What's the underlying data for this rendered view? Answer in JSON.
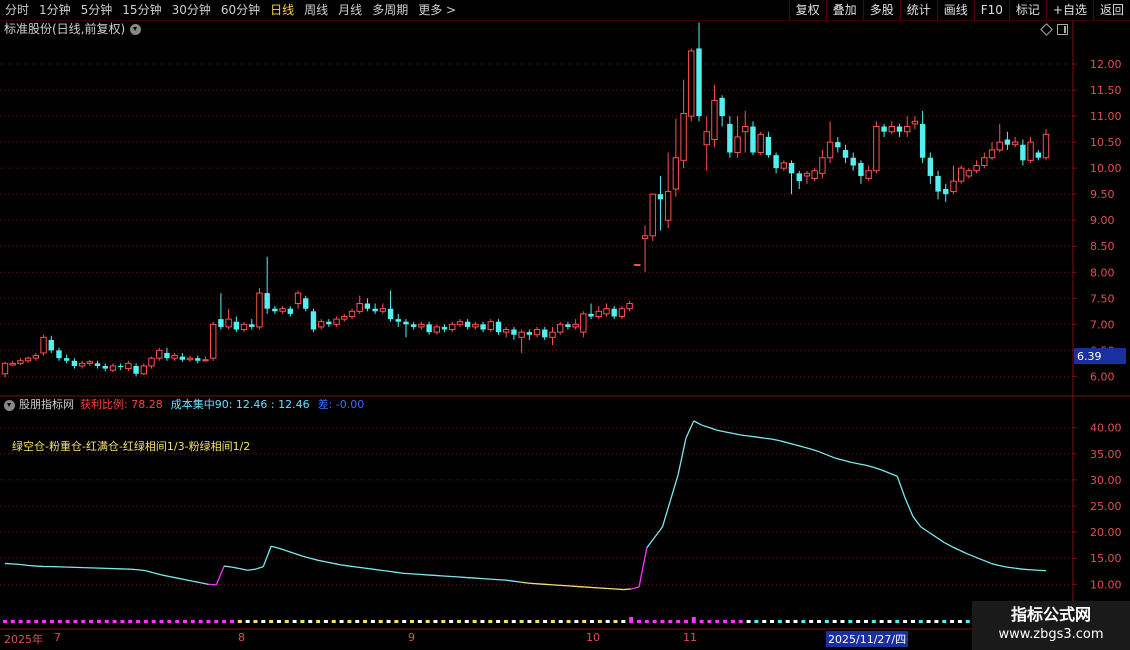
{
  "toolbar": {
    "periods": [
      "分时",
      "1分钟",
      "5分钟",
      "15分钟",
      "30分钟",
      "60分钟",
      "日线",
      "周线",
      "月线",
      "多周期",
      "更多 >"
    ],
    "active_period": "日线",
    "buttons": [
      "复权",
      "叠加",
      "多股",
      "统计",
      "画线",
      "F10",
      "标记",
      "+自选",
      "返回"
    ]
  },
  "chart": {
    "title": "标准股份(日线,前复权)",
    "y_ticks": [
      "12.00",
      "11.50",
      "11.00",
      "10.50",
      "10.00",
      "9.50",
      "9.00",
      "8.50",
      "8.00",
      "7.50",
      "7.00",
      "6.50",
      "6.00"
    ],
    "price_marker": "6.39"
  },
  "indicator": {
    "name": "股朋指标网",
    "profit_label": "获利比例: 78.28",
    "cost_label": "成本集中90: 12.46 : 12.46",
    "diff_label": "差: -0.00",
    "signal_text": "绿空仓-粉重仓-红满仓-红绿相间1/3-粉绿相间1/2",
    "y_ticks": [
      "40.00",
      "35.00",
      "30.00",
      "25.00",
      "20.00",
      "15.00",
      "10.00"
    ]
  },
  "timeline": {
    "year_label": "2025年",
    "months": [
      "7",
      "8",
      "9",
      "10",
      "11"
    ],
    "selected_date": "2025/11/27/四"
  },
  "watermark": {
    "line1": "指标公式网",
    "line2": "www.zbgs3.com"
  },
  "colors": {
    "up": "#ff5050",
    "down": "#54f0f0",
    "grid": "#7a1010",
    "axis_text": "#e05050",
    "accent": "#ffd34a",
    "magenta": "#ff33ff"
  },
  "chart_data": {
    "type": "candlestick",
    "x": "trading days from 2025-06 to 2025-12",
    "ylim": [
      5.7,
      12.5
    ],
    "candles": [
      [
        6.05,
        6.25,
        5.98,
        6.28
      ],
      [
        6.22,
        6.25,
        6.2,
        6.3
      ],
      [
        6.25,
        6.3,
        6.22,
        6.35
      ],
      [
        6.3,
        6.35,
        6.26,
        6.38
      ],
      [
        6.35,
        6.4,
        6.3,
        6.45
      ],
      [
        6.45,
        6.75,
        6.4,
        6.8
      ],
      [
        6.7,
        6.5,
        6.45,
        6.78
      ],
      [
        6.5,
        6.35,
        6.3,
        6.55
      ],
      [
        6.35,
        6.3,
        6.25,
        6.42
      ],
      [
        6.3,
        6.2,
        6.15,
        6.35
      ],
      [
        6.2,
        6.25,
        6.15,
        6.3
      ],
      [
        6.25,
        6.28,
        6.2,
        6.32
      ],
      [
        6.25,
        6.2,
        6.15,
        6.3
      ],
      [
        6.2,
        6.15,
        6.1,
        6.25
      ],
      [
        6.12,
        6.2,
        6.08,
        6.25
      ],
      [
        6.2,
        6.18,
        6.12,
        6.25
      ],
      [
        6.15,
        6.25,
        6.1,
        6.3
      ],
      [
        6.2,
        6.05,
        6.0,
        6.25
      ],
      [
        6.05,
        6.2,
        6.02,
        6.25
      ],
      [
        6.2,
        6.35,
        6.15,
        6.38
      ],
      [
        6.35,
        6.5,
        6.3,
        6.55
      ],
      [
        6.45,
        6.35,
        6.3,
        6.55
      ],
      [
        6.35,
        6.4,
        6.3,
        6.45
      ],
      [
        6.38,
        6.32,
        6.28,
        6.45
      ],
      [
        6.32,
        6.35,
        6.28,
        6.4
      ],
      [
        6.35,
        6.3,
        6.25,
        6.4
      ],
      [
        6.3,
        6.32,
        6.28,
        6.38
      ],
      [
        6.35,
        7.0,
        6.3,
        7.05
      ],
      [
        7.1,
        6.95,
        6.9,
        7.6
      ],
      [
        6.95,
        7.1,
        6.9,
        7.3
      ],
      [
        7.05,
        6.9,
        6.85,
        7.15
      ],
      [
        6.9,
        7.0,
        6.85,
        7.05
      ],
      [
        7.0,
        6.95,
        6.9,
        7.1
      ],
      [
        6.95,
        7.6,
        6.9,
        7.7
      ],
      [
        7.6,
        7.3,
        7.2,
        8.3
      ],
      [
        7.3,
        7.25,
        7.2,
        7.35
      ],
      [
        7.25,
        7.3,
        7.2,
        7.35
      ],
      [
        7.3,
        7.2,
        7.15,
        7.35
      ],
      [
        7.4,
        7.6,
        7.3,
        7.65
      ],
      [
        7.5,
        7.3,
        7.25,
        7.55
      ],
      [
        7.25,
        6.9,
        6.85,
        7.3
      ],
      [
        6.95,
        7.05,
        6.9,
        7.1
      ],
      [
        7.05,
        7.0,
        6.95,
        7.1
      ],
      [
        7.0,
        7.1,
        6.95,
        7.15
      ],
      [
        7.1,
        7.15,
        7.05,
        7.2
      ],
      [
        7.15,
        7.25,
        7.1,
        7.3
      ],
      [
        7.25,
        7.4,
        7.2,
        7.55
      ],
      [
        7.4,
        7.3,
        7.25,
        7.5
      ],
      [
        7.3,
        7.25,
        7.2,
        7.4
      ],
      [
        7.25,
        7.3,
        7.2,
        7.4
      ],
      [
        7.3,
        7.1,
        7.05,
        7.65
      ],
      [
        7.1,
        7.05,
        6.95,
        7.2
      ],
      [
        7.05,
        7.0,
        6.75,
        7.1
      ],
      [
        7.0,
        6.95,
        6.9,
        7.05
      ],
      [
        6.95,
        7.0,
        6.9,
        7.05
      ],
      [
        7.0,
        6.85,
        6.8,
        7.05
      ],
      [
        6.85,
        6.95,
        6.8,
        7.0
      ],
      [
        6.95,
        6.9,
        6.85,
        7.0
      ],
      [
        6.9,
        7.0,
        6.85,
        7.05
      ],
      [
        7.0,
        7.05,
        6.95,
        7.1
      ],
      [
        7.05,
        6.95,
        6.9,
        7.1
      ],
      [
        6.95,
        7.0,
        6.9,
        7.05
      ],
      [
        7.0,
        6.9,
        6.85,
        7.05
      ],
      [
        6.9,
        7.05,
        6.85,
        7.1
      ],
      [
        7.05,
        6.85,
        6.8,
        7.1
      ],
      [
        6.85,
        6.9,
        6.75,
        6.95
      ],
      [
        6.9,
        6.8,
        6.7,
        6.95
      ],
      [
        6.75,
        6.85,
        6.45,
        6.9
      ],
      [
        6.85,
        6.8,
        6.7,
        6.9
      ],
      [
        6.8,
        6.9,
        6.75,
        6.95
      ],
      [
        6.9,
        6.75,
        6.7,
        6.95
      ],
      [
        6.75,
        6.85,
        6.6,
        6.95
      ],
      [
        6.85,
        7.0,
        6.8,
        7.05
      ],
      [
        7.0,
        6.95,
        6.9,
        7.05
      ],
      [
        6.95,
        7.0,
        6.9,
        7.1
      ],
      [
        6.85,
        7.2,
        6.75,
        7.25
      ],
      [
        7.2,
        7.15,
        7.1,
        7.4
      ],
      [
        7.15,
        7.25,
        7.1,
        7.35
      ],
      [
        7.2,
        7.3,
        7.15,
        7.4
      ],
      [
        7.3,
        7.15,
        7.1,
        7.35
      ],
      [
        7.15,
        7.3,
        7.1,
        7.35
      ],
      [
        7.3,
        7.4,
        7.25,
        7.45
      ],
      [
        8.15,
        8.15,
        8.15,
        8.15
      ],
      [
        8.65,
        8.7,
        8.0,
        8.9
      ],
      [
        8.7,
        9.5,
        8.6,
        9.5
      ],
      [
        9.5,
        9.4,
        8.8,
        9.85
      ],
      [
        9.0,
        9.55,
        8.85,
        10.3
      ],
      [
        9.6,
        10.2,
        9.45,
        10.95
      ],
      [
        10.15,
        11.05,
        10.0,
        11.7
      ],
      [
        11.0,
        12.25,
        10.9,
        12.3
      ],
      [
        12.3,
        11.0,
        10.9,
        12.8
      ],
      [
        10.45,
        10.7,
        9.95,
        11.0
      ],
      [
        10.55,
        11.3,
        10.4,
        11.6
      ],
      [
        11.35,
        11.0,
        10.8,
        11.4
      ],
      [
        10.85,
        10.3,
        10.2,
        11.0
      ],
      [
        10.3,
        10.6,
        10.2,
        11.0
      ],
      [
        10.7,
        10.8,
        10.3,
        11.1
      ],
      [
        10.8,
        10.3,
        10.25,
        10.9
      ],
      [
        10.3,
        10.65,
        10.25,
        10.7
      ],
      [
        10.6,
        10.25,
        10.2,
        10.7
      ],
      [
        10.25,
        10.0,
        9.9,
        10.3
      ],
      [
        10.0,
        10.1,
        9.95,
        10.15
      ],
      [
        10.1,
        9.9,
        9.5,
        10.15
      ],
      [
        9.9,
        9.75,
        9.6,
        9.95
      ],
      [
        9.85,
        9.9,
        9.7,
        9.95
      ],
      [
        9.8,
        9.95,
        9.75,
        10.0
      ],
      [
        9.9,
        10.2,
        9.8,
        10.35
      ],
      [
        10.2,
        10.5,
        10.1,
        10.9
      ],
      [
        10.5,
        10.4,
        10.3,
        10.6
      ],
      [
        10.35,
        10.2,
        10.1,
        10.45
      ],
      [
        10.2,
        10.05,
        9.95,
        10.3
      ],
      [
        10.1,
        9.85,
        9.7,
        10.15
      ],
      [
        9.8,
        9.95,
        9.75,
        10.05
      ],
      [
        9.95,
        10.8,
        9.9,
        10.9
      ],
      [
        10.8,
        10.7,
        10.6,
        10.85
      ],
      [
        10.7,
        10.8,
        10.65,
        10.9
      ],
      [
        10.8,
        10.7,
        10.6,
        10.85
      ],
      [
        10.7,
        10.8,
        10.6,
        11.0
      ],
      [
        10.85,
        10.9,
        10.75,
        11.0
      ],
      [
        10.85,
        10.2,
        10.1,
        11.1
      ],
      [
        10.2,
        9.85,
        9.7,
        10.3
      ],
      [
        9.85,
        9.55,
        9.4,
        9.95
      ],
      [
        9.6,
        9.5,
        9.35,
        9.7
      ],
      [
        9.55,
        9.75,
        9.5,
        10.05
      ],
      [
        9.75,
        10.0,
        9.7,
        10.05
      ],
      [
        9.85,
        9.95,
        9.8,
        10.0
      ],
      [
        9.95,
        10.05,
        9.9,
        10.15
      ],
      [
        10.05,
        10.2,
        10.0,
        10.3
      ],
      [
        10.2,
        10.35,
        10.15,
        10.5
      ],
      [
        10.35,
        10.5,
        10.3,
        10.85
      ],
      [
        10.55,
        10.45,
        10.35,
        10.7
      ],
      [
        10.45,
        10.5,
        10.4,
        10.6
      ],
      [
        10.45,
        10.15,
        10.05,
        10.55
      ],
      [
        10.15,
        10.5,
        10.1,
        10.6
      ],
      [
        10.3,
        10.2,
        10.15,
        10.35
      ],
      [
        10.2,
        10.65,
        10.15,
        10.75
      ]
    ],
    "indicator_series": {
      "name": "获利比例",
      "ylim": [
        7,
        43
      ],
      "values": [
        14.0,
        13.9,
        13.8,
        13.6,
        13.5,
        13.4,
        13.4,
        13.35,
        13.3,
        13.25,
        13.2,
        13.15,
        13.1,
        13.05,
        13.0,
        12.95,
        12.9,
        12.8,
        12.6,
        12.2,
        11.8,
        11.5,
        11.2,
        10.9,
        10.6,
        10.3,
        10.0,
        9.9,
        13.5,
        13.3,
        13.0,
        12.7,
        12.9,
        13.4,
        17.3,
        16.9,
        16.4,
        15.9,
        15.4,
        15.0,
        14.6,
        14.3,
        14.0,
        13.7,
        13.5,
        13.3,
        13.1,
        12.9,
        12.7,
        12.5,
        12.3,
        12.1,
        12.0,
        11.9,
        11.8,
        11.7,
        11.6,
        11.5,
        11.4,
        11.3,
        11.2,
        11.1,
        11.0,
        10.9,
        10.8,
        10.6,
        10.4,
        10.2,
        10.1,
        10.0,
        9.9,
        9.8,
        9.7,
        9.6,
        9.5,
        9.4,
        9.3,
        9.2,
        9.1,
        9.0,
        9.1,
        9.5,
        17.0,
        19.0,
        21.0,
        26.0,
        31.0,
        38.0,
        41.3,
        40.5,
        40.0,
        39.5,
        39.2,
        38.9,
        38.6,
        38.4,
        38.2,
        38.0,
        37.8,
        37.5,
        37.1,
        36.7,
        36.3,
        35.9,
        35.4,
        34.8,
        34.2,
        33.8,
        33.4,
        33.1,
        32.8,
        32.4,
        31.9,
        31.3,
        30.7,
        26.5,
        23.0,
        21.0,
        20.0,
        19.0,
        18.0,
        17.2,
        16.5,
        15.8,
        15.2,
        14.6,
        14.0,
        13.6,
        13.3,
        13.1,
        12.9,
        12.8,
        12.7,
        12.6
      ]
    }
  }
}
